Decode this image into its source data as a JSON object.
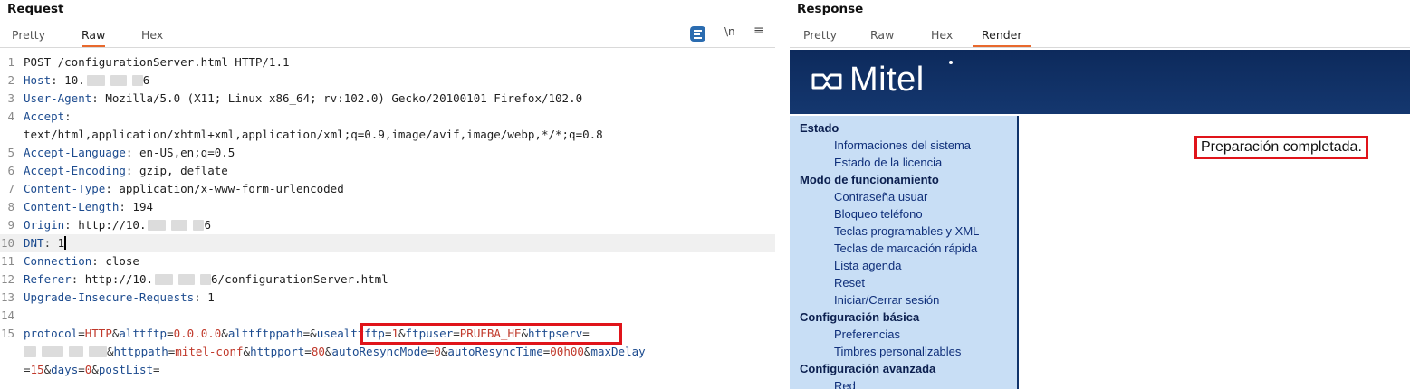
{
  "request": {
    "title": "Request",
    "tabs": [
      "Pretty",
      "Raw",
      "Hex"
    ],
    "active_tab": "Raw",
    "toolbar": {
      "wrap_icon": "text-wrap-icon",
      "newline_label": "\\n",
      "menu_icon": "hamburger-menu-icon"
    },
    "lines": [
      {
        "n": "1",
        "request_line": "POST /configurationServer.html HTTP/1.1"
      },
      {
        "n": "2",
        "key": "Host",
        "value_pre": "10.",
        "value_post": "6"
      },
      {
        "n": "3",
        "key": "User-Agent",
        "value": "Mozilla/5.0 (X11; Linux x86_64; rv:102.0) Gecko/20100101 Firefox/102.0"
      },
      {
        "n": "4",
        "key": "Accept",
        "value_cont": "text/html,application/xhtml+xml,application/xml;q=0.9,image/avif,image/webp,*/*;q=0.8"
      },
      {
        "n": "5",
        "key": "Accept-Language",
        "value": "en-US,en;q=0.5"
      },
      {
        "n": "6",
        "key": "Accept-Encoding",
        "value": "gzip, deflate"
      },
      {
        "n": "7",
        "key": "Content-Type",
        "value": "application/x-www-form-urlencoded"
      },
      {
        "n": "8",
        "key": "Content-Length",
        "value": "194"
      },
      {
        "n": "9",
        "key": "Origin",
        "value_pre": "http://10.",
        "value_post": "6"
      },
      {
        "n": "10",
        "key": "DNT",
        "value": "1"
      },
      {
        "n": "11",
        "key": "Connection",
        "value": "close"
      },
      {
        "n": "12",
        "key": "Referer",
        "value_pre": "http://10.",
        "value_post": "6/configurationServer.html"
      },
      {
        "n": "13",
        "key": "Upgrade-Insecure-Requests",
        "value": "1"
      },
      {
        "n": "14"
      },
      {
        "n": "15"
      }
    ],
    "body_params": [
      {
        "name": "protocol",
        "value": "HTTP"
      },
      {
        "name": "alttftp",
        "value": "0.0.0.0"
      },
      {
        "name": "alttftppath",
        "value": ""
      },
      {
        "name": "usealttftp",
        "value": "1"
      },
      {
        "name": "ftpuser",
        "value": "PRUEBA_HE"
      },
      {
        "name": "httpserv",
        "value": ""
      },
      {
        "name": "httppath",
        "value": "mitel-conf"
      },
      {
        "name": "httpport",
        "value": "80"
      },
      {
        "name": "autoResyncMode",
        "value": "0"
      },
      {
        "name": "autoResyncTime",
        "value": "00h00"
      },
      {
        "name": "maxDelay",
        "value": "15"
      },
      {
        "name": "days",
        "value": "0"
      },
      {
        "name": "postList",
        "value": ""
      }
    ]
  },
  "response": {
    "title": "Response",
    "tabs": [
      "Pretty",
      "Raw",
      "Hex",
      "Render"
    ],
    "active_tab": "Render",
    "render": {
      "logo_text": "Mitel",
      "header_color": "#14376f",
      "menu": [
        {
          "heading": "Estado",
          "items": [
            "Informaciones del sistema",
            "Estado de la licencia"
          ]
        },
        {
          "heading": "Modo de funcionamiento",
          "items": [
            "Contraseña usuar",
            "Bloqueo teléfono",
            "Teclas programables y XML",
            "Teclas de marcación rápida",
            "Lista agenda",
            "Reset",
            "Iniciar/Cerrar sesión"
          ]
        },
        {
          "heading": "Configuración básica",
          "items": [
            "Preferencias",
            "Timbres personalizables"
          ]
        },
        {
          "heading": "Configuración avanzada",
          "items": [
            "Red"
          ]
        }
      ],
      "status_message": "Preparación completada."
    }
  },
  "colors": {
    "accent": "#e8692d",
    "highlight_box": "#e0141a",
    "menu_bg": "#c8def5"
  }
}
